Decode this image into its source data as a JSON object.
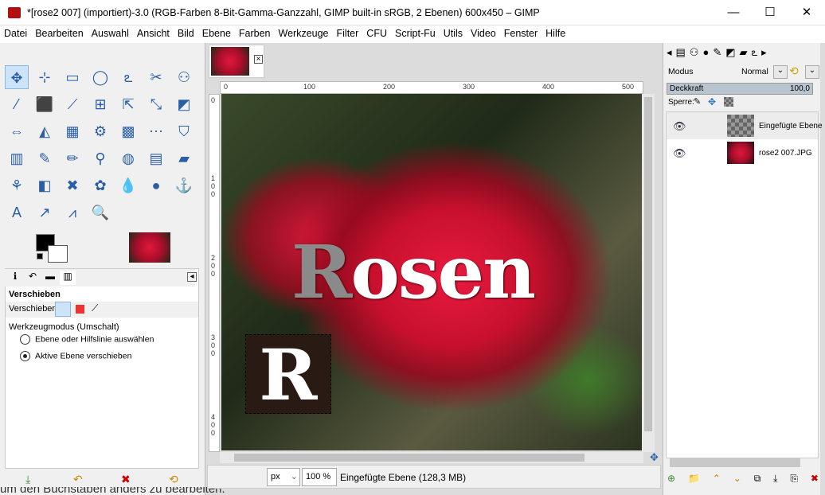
{
  "window": {
    "title": "*[rose2 007] (importiert)-3.0 (RGB-Farben 8-Bit-Gamma-Ganzzahl, GIMP built-in sRGB, 2 Ebenen) 600x450 – GIMP",
    "minimize": "—",
    "maximize": "☐",
    "close": "✕"
  },
  "menu": [
    "Datei",
    "Bearbeiten",
    "Auswahl",
    "Ansicht",
    "Bild",
    "Ebene",
    "Farben",
    "Werkzeuge",
    "Filter",
    "CFU",
    "Script-Fu",
    "Utils",
    "Video",
    "Fenster",
    "Hilfe"
  ],
  "tools": [
    "✥",
    "⊹",
    "▭",
    "◯",
    "ఽ",
    "✂",
    "⚇",
    "⁄",
    "⬛",
    "⟋",
    "⊞",
    "⇱",
    "⤡",
    "◩",
    "⇔",
    "◭",
    "▦",
    "⚙",
    "▩",
    "⋯",
    "⛉",
    "▥",
    "✎",
    "✏",
    "⚲",
    "◍",
    "▤",
    "▰",
    "⚘",
    "◧",
    "✖",
    "✿",
    "💧",
    "●",
    "⚓",
    "A",
    "↗",
    "⩘",
    "🔍"
  ],
  "tool_options": {
    "tabs": [
      "ℹ",
      "↶",
      "▬",
      "▥"
    ],
    "title": "Verschieben",
    "move_label": "Verschieben:",
    "mode_label": "Werkzeugmodus (Umschalt)",
    "radio1": "Ebene oder Hilfslinie auswählen",
    "radio2": "Aktive Ebene verschieben",
    "bottom_buttons": [
      "⤓",
      "↶",
      "✖",
      "⟲"
    ]
  },
  "canvas": {
    "ruler_h": [
      "0",
      "100",
      "200",
      "300",
      "400",
      "500"
    ],
    "ruler_v": [
      "0",
      "100",
      "200",
      "300",
      "400"
    ],
    "text_main": "Rosen",
    "text_letter": "R"
  },
  "status": {
    "unit": "px",
    "zoom": "100 %",
    "info": "Eingefügte Ebene (128,3 MB)"
  },
  "layers_panel": {
    "mode_label": "Modus",
    "mode_value": "Normal",
    "opacity_label": "Deckkraft",
    "opacity_value": "100,0",
    "lock_label": "Sperre:",
    "layers": [
      {
        "name": "Eingefügte Ebene"
      },
      {
        "name": "rose2 007.JPG"
      }
    ],
    "bottom_buttons": [
      "⊕",
      "📁",
      "⌃",
      "⌄",
      "⧉",
      "⤓",
      "⎘",
      "✖"
    ]
  },
  "background_text": "um den Buchstaben anders zu bearbeiten."
}
